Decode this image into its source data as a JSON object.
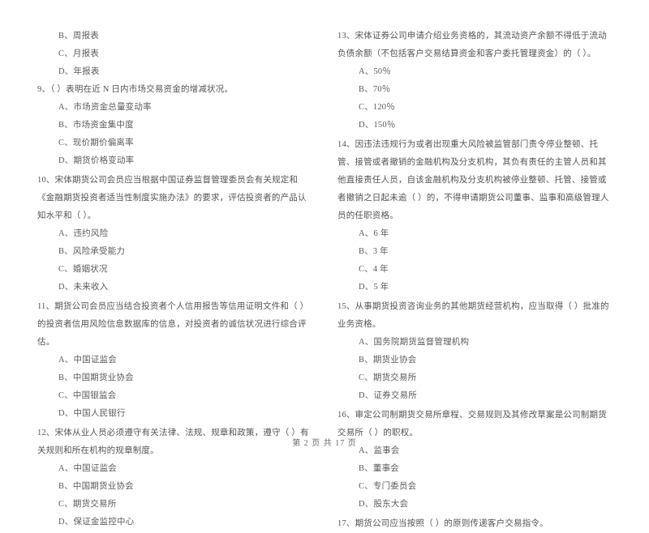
{
  "document": {
    "footer": "第 2 页 共 17 页",
    "page_number": "2",
    "total_pages": "17"
  },
  "left_column": {
    "leading_options": [
      "B、周报表",
      "C、月报表",
      "D、年报表"
    ],
    "questions": [
      {
        "stem": "9、（      ）表明在近 N 日内市场交易资金的增减状况。",
        "options": [
          "A、市场资金总量变动率",
          "B、市场资金集中度",
          "C、现价期价偏离率",
          "D、期货价格变动率"
        ]
      },
      {
        "stem": "10、宋体期货公司会员应当根据中国证券监督管理委员会有关规定和《金融期货投资者适当性制度实施办法》的要求，评估投资者的产品认知水平和（      ）。",
        "options": [
          "A、违约风险",
          "B、风险承受能力",
          "C、婚姻状况",
          "D、未来收入"
        ]
      },
      {
        "stem": "11、期货公司会员应当结合投资者个人信用报告等信用证明文件和（      ）的投资者信用风险信息数据库的信息，对投资者的诚信状况进行综合评估。",
        "options": [
          "A、中国证监会",
          "B、中国期货业协会",
          "C、中国银监会",
          "D、中国人民银行"
        ]
      },
      {
        "stem": "12、宋体从业人员必须遵守有关法律、法规、规章和政策，遵守（      ）有关规则和所在机构的规章制度。",
        "options": [
          "A、中国证监会",
          "B、中国期货业协会",
          "C、期货交易所",
          "D、保证金监控中心"
        ]
      }
    ]
  },
  "right_column": {
    "questions": [
      {
        "stem": "13、宋体证券公司申请介绍业务资格的，其流动资产余额不得低于流动负债余额（不包括客户交易结算资金和客户委托管理资金）的（      ）。",
        "options": [
          "A、50％",
          "B、70％",
          "C、120％",
          "D、150％"
        ]
      },
      {
        "stem": "14、因违法违规行为或者出现重大风险被监管部门责令停业整顿、托管、接管或者撤销的金融机构及分支机构，其负有责任的主管人员和其他直接责任人员，自该金融机构及分支机构被停业整顿、托管、接管或者撤销之日起未逾（      ）的，不得申请期货公司董事、监事和高级管理人员的任职资格。",
        "options": [
          "A、6 年",
          "B、3 年",
          "C、4 年",
          "D、5 年"
        ]
      },
      {
        "stem": "15、从事期货投资咨询业务的其他期货经营机构，应当取得（      ）批准的业务资格。",
        "options": [
          "A、国务院期货监督管理机构",
          "B、期货业协会",
          "C、期货交易所",
          "D、证券交易所"
        ]
      },
      {
        "stem": "16、审定公司制期货交易所章程、交易规则及其修改草案是公司制期货交易所（      ）的职权。",
        "options": [
          "A、监事会",
          "B、董事会",
          "C、专门委员会",
          "D、股东大会"
        ]
      },
      {
        "stem": "17、期货公司应当按照（      ）的原则传递客户交易指令。",
        "options": []
      }
    ]
  }
}
